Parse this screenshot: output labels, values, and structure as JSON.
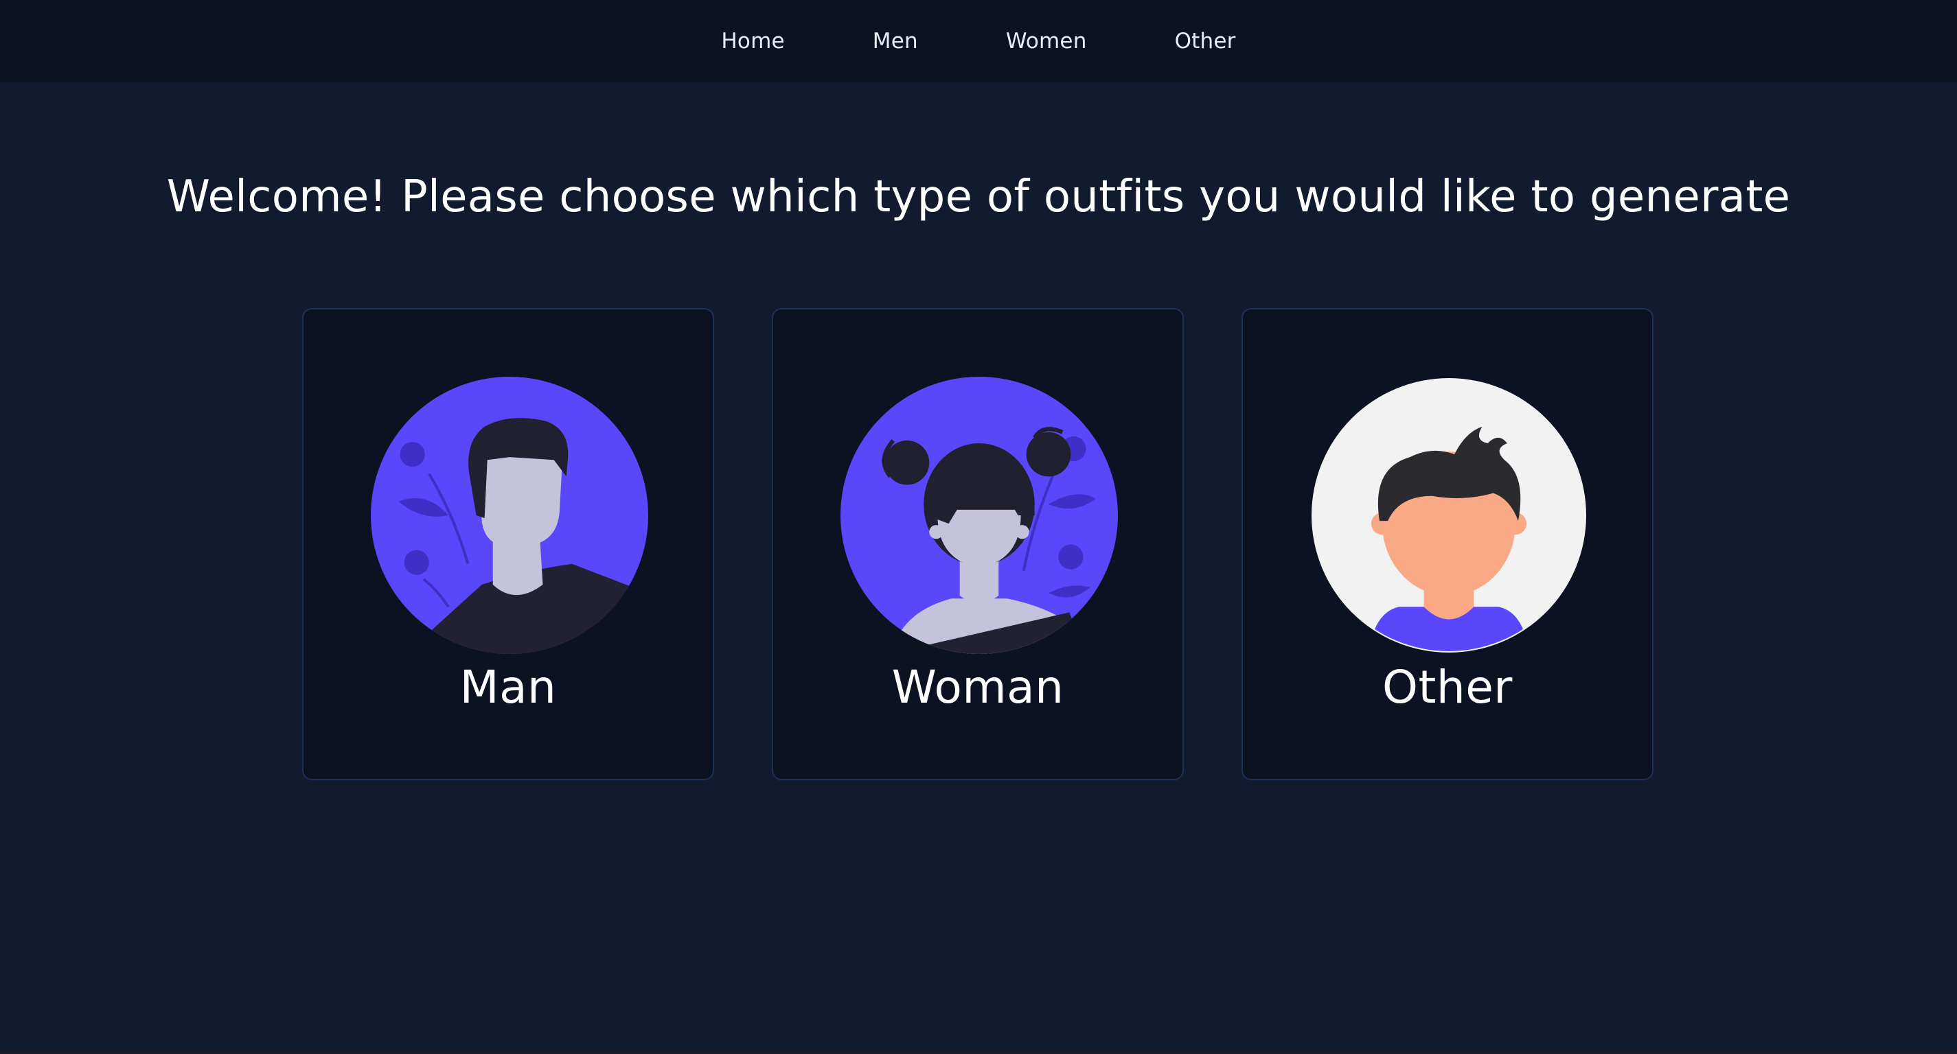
{
  "nav": {
    "items": [
      {
        "label": "Home"
      },
      {
        "label": "Men"
      },
      {
        "label": "Women"
      },
      {
        "label": "Other"
      }
    ]
  },
  "main": {
    "headline": "Welcome! Please choose which type of outfits you would like to generate"
  },
  "cards": [
    {
      "label": "Man",
      "avatar_icon": "man-avatar-icon"
    },
    {
      "label": "Woman",
      "avatar_icon": "woman-avatar-icon"
    },
    {
      "label": "Other",
      "avatar_icon": "other-avatar-icon"
    }
  ],
  "colors": {
    "background": "#111a2e",
    "navbar": "#0c1221",
    "card": "#0d1222",
    "card_border": "#1e2f58",
    "accent_purple": "#5b47fb",
    "skin_light": "#c5c3dc",
    "skin_peach": "#f9a986",
    "hair_dark": "#212030"
  }
}
